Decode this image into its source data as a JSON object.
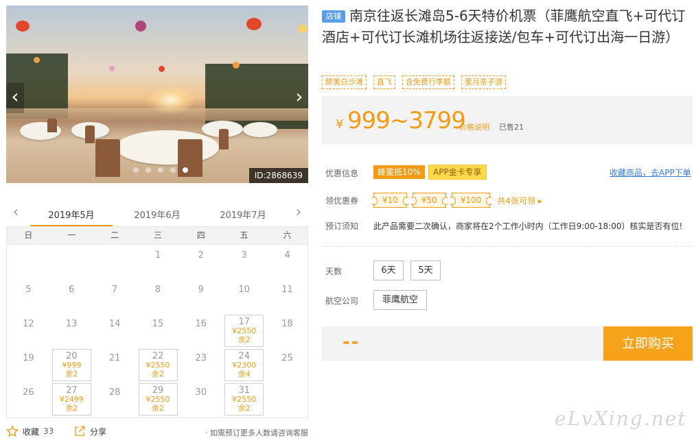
{
  "hero": {
    "image_id": "ID:2868639",
    "dots": 5,
    "active_dot": 4
  },
  "calendar": {
    "months": [
      "2019年5月",
      "2019年6月",
      "2019年7月"
    ],
    "active_month": 0,
    "weekdays": [
      "日",
      "一",
      "二",
      "三",
      "四",
      "五",
      "六"
    ],
    "days": [
      {
        "n": ""
      },
      {
        "n": ""
      },
      {
        "n": ""
      },
      {
        "n": "1"
      },
      {
        "n": "2"
      },
      {
        "n": "3"
      },
      {
        "n": "4"
      },
      {
        "n": "5"
      },
      {
        "n": "6"
      },
      {
        "n": "7"
      },
      {
        "n": "8"
      },
      {
        "n": "9"
      },
      {
        "n": "10"
      },
      {
        "n": "11"
      },
      {
        "n": "12"
      },
      {
        "n": "13"
      },
      {
        "n": "14"
      },
      {
        "n": "15"
      },
      {
        "n": "16"
      },
      {
        "n": "17",
        "price": "¥2550",
        "left": "余2"
      },
      {
        "n": "18"
      },
      {
        "n": "19"
      },
      {
        "n": "20",
        "price": "¥999",
        "left": "余2"
      },
      {
        "n": "21"
      },
      {
        "n": "22",
        "price": "¥2550",
        "left": "余2"
      },
      {
        "n": "23"
      },
      {
        "n": "24",
        "price": "¥2300",
        "left": "余4"
      },
      {
        "n": "25"
      },
      {
        "n": "26"
      },
      {
        "n": "27",
        "price": "¥2499",
        "left": "余2"
      },
      {
        "n": "28"
      },
      {
        "n": "29",
        "price": "¥2550",
        "left": "余2"
      },
      {
        "n": "30"
      },
      {
        "n": "31",
        "price": "¥2550",
        "left": "余2"
      },
      {
        "n": ""
      }
    ]
  },
  "footer": {
    "fav_label": "收藏",
    "fav_count": "33",
    "share_label": "分享",
    "hint": "· 如需预订更多人数请咨询客服"
  },
  "product": {
    "shop_tag": "店铺",
    "title": "南京往返长滩岛5-6天特价机票（菲鹰航空直飞+可代订酒店+可代订长滩机场往返接送/包车+可代订出海一日游）",
    "tags": [
      "醉美白沙滩",
      "直飞",
      "含免费行李额",
      "蜜月亲子游"
    ]
  },
  "price": {
    "yen": "¥",
    "range": "999~3799",
    "note": "价格说明",
    "sold": "已售21"
  },
  "info": {
    "promo_label": "优惠信息",
    "promo_badge1": "蜂蜜抵10%",
    "promo_badge2": "APP金卡专享",
    "fav_app_link": "收藏商品，去APP下单",
    "coupon_label": "领优惠券",
    "coupons": [
      "¥10",
      "¥50",
      "¥100"
    ],
    "coupon_more": "共4张可领 ▸",
    "notice_label": "预订须知",
    "notice_text": "此产品需要二次确认，商家将在2个工作小时内（工作日9:00-18:00）核实是否有位!"
  },
  "options": {
    "days_label": "天数",
    "days": [
      "6天",
      "5天"
    ],
    "airline_label": "航空公司",
    "airlines": [
      "菲鹰航空"
    ]
  },
  "buy": {
    "price_placeholder": "--",
    "button": "立即购买"
  },
  "watermark": "eLvXing.net",
  "colors": {
    "accent": "#f39b14",
    "link": "#3a7bd5",
    "shop_tag": "#5b9ee8"
  }
}
